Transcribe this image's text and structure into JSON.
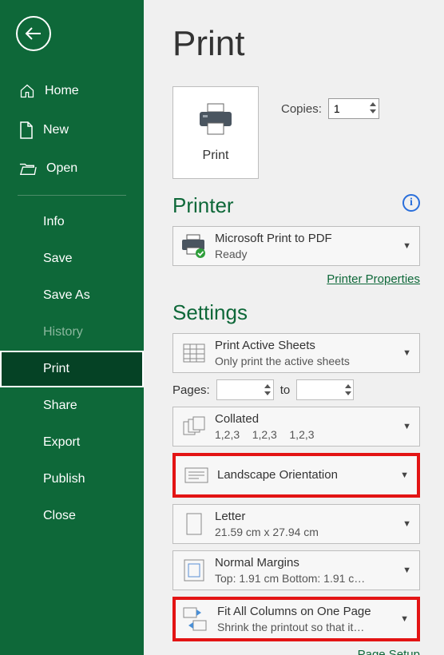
{
  "sidebar": {
    "items": [
      {
        "label": "Home"
      },
      {
        "label": "New"
      },
      {
        "label": "Open"
      },
      {
        "label": "Info"
      },
      {
        "label": "Save"
      },
      {
        "label": "Save As"
      },
      {
        "label": "History"
      },
      {
        "label": "Print"
      },
      {
        "label": "Share"
      },
      {
        "label": "Export"
      },
      {
        "label": "Publish"
      },
      {
        "label": "Close"
      }
    ]
  },
  "page": {
    "title": "Print",
    "printButton": "Print",
    "copiesLabel": "Copies:",
    "copiesValue": "1",
    "printerHeading": "Printer",
    "printer": {
      "name": "Microsoft Print to PDF",
      "status": "Ready"
    },
    "printerPropsLink": "Printer Properties",
    "settingsHeading": "Settings",
    "pagesLabel": "Pages:",
    "pagesTo": "to",
    "pageSetupLink": "Page Setup",
    "settings": [
      {
        "title": "Print Active Sheets",
        "sub": "Only print the active sheets"
      },
      {
        "title": "Collated",
        "sub": "1,2,3    1,2,3    1,2,3"
      },
      {
        "title": "Landscape Orientation",
        "sub": ""
      },
      {
        "title": "Letter",
        "sub": "21.59 cm x 27.94 cm"
      },
      {
        "title": "Normal Margins",
        "sub": "Top: 1.91 cm Bottom: 1.91 c…"
      },
      {
        "title": "Fit All Columns on One Page",
        "sub": "Shrink the printout so that it…"
      }
    ]
  }
}
